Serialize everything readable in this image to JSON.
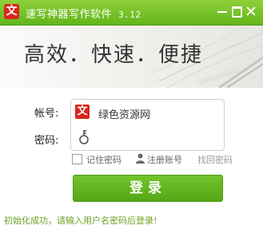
{
  "window": {
    "app_icon_glyph": "文",
    "title": "速写神器写作软件",
    "version": "3.12",
    "icons": {
      "minimize": "minimize-icon",
      "maximize": "maximize-icon",
      "close": "close-icon"
    }
  },
  "banner": {
    "slogan": "高效．快速．便捷"
  },
  "form": {
    "account_label": "帐号:",
    "account_icon_glyph": "文",
    "account_value": "绿色资源网",
    "password_label": "密码:",
    "password_value": "",
    "remember_label": "记住密码",
    "remember_checked": false,
    "register_label": "注册账号",
    "find_password_label": "找回密码",
    "login_label": "登录"
  },
  "status": {
    "message": "初始化成功，请输入用户名密码后登录!"
  },
  "colors": {
    "title_bar": "#63b51b",
    "accent_green": "#55a716",
    "icon_red": "#d9261c",
    "status_text": "#6da222"
  }
}
